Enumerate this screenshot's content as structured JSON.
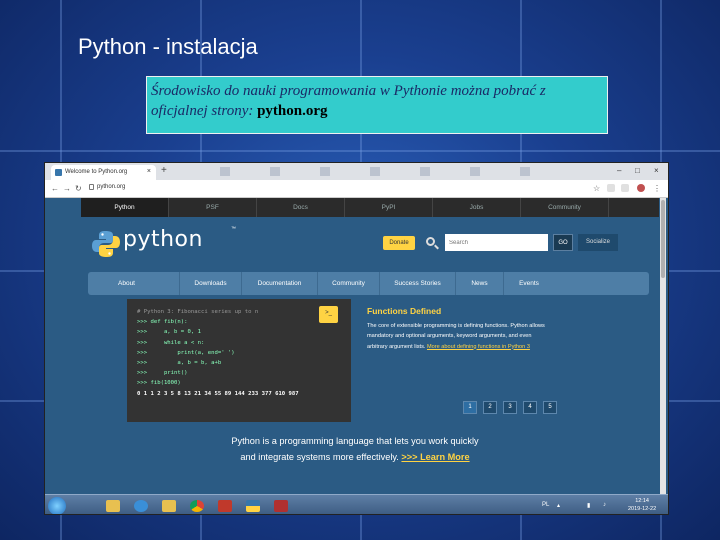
{
  "slide": {
    "title": "Python - instalacja",
    "callout_text": "Środowisko do nauki programowania w Pythonie można pobrać z oficjalnej strony: ",
    "callout_link": "python.org"
  },
  "browser": {
    "tab_title": "Welcome to Python.org",
    "tab_close": "×",
    "new_tab": "+",
    "url": "python.org",
    "window_min": "–",
    "window_max": "□",
    "window_close": "×"
  },
  "site": {
    "topnav": [
      "Python",
      "PSF",
      "Docs",
      "PyPI",
      "Jobs",
      "Community"
    ],
    "logo_text": "python",
    "logo_tm": "™",
    "donate_label": "Donate",
    "search_placeholder": "Search",
    "go_label": "GO",
    "socialize_label": "Socialize",
    "menu": [
      "About",
      "Downloads",
      "Documentation",
      "Community",
      "Success Stories",
      "News",
      "Events"
    ],
    "code": {
      "line1": "# Python 3: Fibonacci series up to n",
      "line2": ">>> def fib(n):",
      "line3": ">>>     a, b = 0, 1",
      "line4": ">>>     while a < n:",
      "line5": ">>>         print(a, end=' ')",
      "line6": ">>>         a, b = b, a+b",
      "line7": ">>>     print()",
      "line8": ">>> fib(1000)",
      "output": "0 1 1 2 3 5 8 13 21 34 55 89 144 233 377 610 987"
    },
    "shell_label": ">_",
    "feature_title": "Functions Defined",
    "feature_text": "The core of extensible programming is defining functions. Python allows mandatory and optional arguments, keyword arguments, and even arbitrary argument lists. ",
    "feature_link": "More about defining functions in Python 3",
    "pager": [
      "1",
      "2",
      "3",
      "4",
      "5"
    ],
    "tagline_1": "Python is a programming language that lets you work quickly",
    "tagline_2": "and integrate systems more effectively. ",
    "tagline_link": ">>> Learn More"
  },
  "taskbar": {
    "tray_text": "PL",
    "clock_time": "12:14",
    "clock_date": "2019-12-22"
  }
}
